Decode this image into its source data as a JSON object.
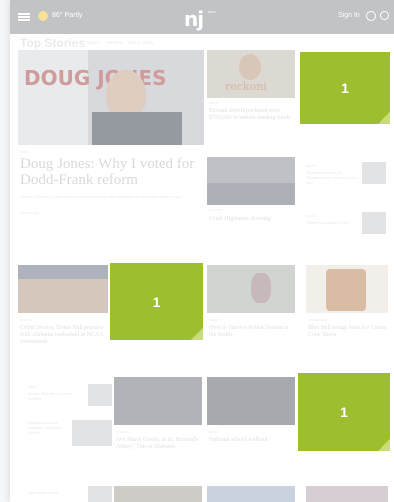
{
  "header": {
    "weather": "86° Partly",
    "logo": "nj",
    "logo_sub": "com",
    "signin": "Sign In",
    "user_icon": "user-icon",
    "search_icon": "search-icon",
    "menu_icon": "menu-icon"
  },
  "section": {
    "title": "Top Stories",
    "nav": [
      "NEWS",
      "SPORTS",
      "LIVE & LOCAL"
    ]
  },
  "lead": {
    "photo_text": "DOUG JONES",
    "headline": "Doug Jones: Why I voted for Dodd-Frank reform",
    "summary": "\"As your Senator, I have made a point of working with colleagues to bring real results to you.\"",
    "time": "Yesterday ago"
  },
  "stories": [
    {
      "label": "NEWS",
      "headline": "Etowah sheriff pocketed over $750,000 in inmate-feeding funds",
      "photo_text": "reckoni"
    },
    {
      "label": "NEWS",
      "headline": "Reading versions of 'Shakespeare' moving South end"
    },
    {
      "label": "GALLERY",
      "headline": "Uriah Highlands shooting"
    },
    {
      "label": "NEWS",
      "headline": "Clifton east Mark ICE16"
    },
    {
      "label": "SPORTS",
      "headline": "Collin Sexton, Donta Hall practice with Alabama basketball at NCAA tournament"
    },
    {
      "label": "NEWS",
      "headline": "How to Survive Pollen Season in the South"
    },
    {
      "label": "SPONSORED",
      "headline": "Blue Bell brings back Ice Cream Cone flavor"
    },
    {
      "label": "NEWS",
      "headline": "Steam Sweden Emperor brought"
    },
    {
      "label": "GALLERY",
      "headline": "Ave Maria Grotto, at St. Bernard's Abbey | This is Alabama"
    },
    {
      "label": "NEWS",
      "headline": "National school walkout"
    },
    {
      "label": "NEWS",
      "headline": "Alabama student walkout - Hundreds Attend"
    },
    {
      "label": "NEWS",
      "headline": "Auto video list lot"
    }
  ],
  "badges": [
    "1",
    "1",
    "1"
  ],
  "colors": {
    "badge": "#9dbe2f",
    "topbar": "#8e9296",
    "sun": "#f2c640"
  }
}
